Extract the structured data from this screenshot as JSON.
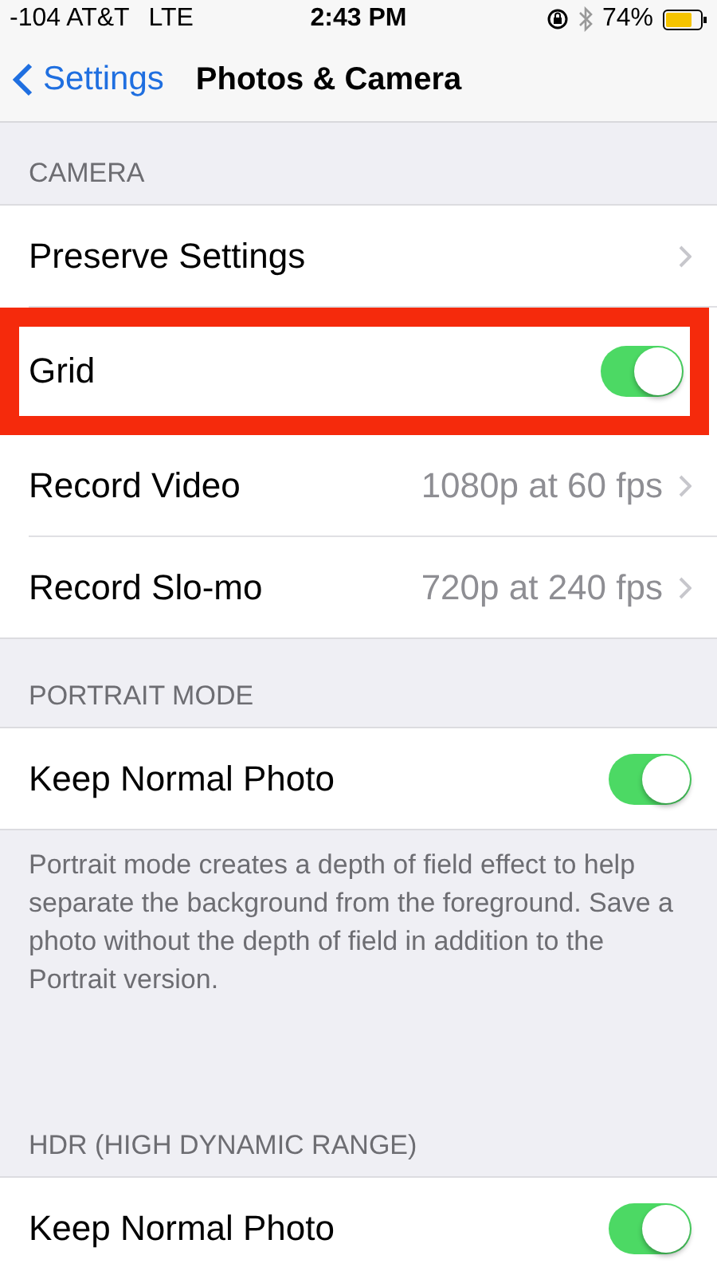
{
  "status_bar": {
    "carrier": "-104 AT&T",
    "network": "LTE",
    "time": "2:43 PM",
    "battery": "74%"
  },
  "nav": {
    "back": "Settings",
    "title": "Photos & Camera"
  },
  "sections": [
    {
      "header": "CAMERA",
      "rows": [
        {
          "kind": "link",
          "label": "Preserve Settings",
          "highlighted": false
        },
        {
          "kind": "toggle",
          "label": "Grid",
          "on": true,
          "highlighted": true
        },
        {
          "kind": "link",
          "label": "Record Video",
          "value": "1080p at 60 fps",
          "highlighted": false
        },
        {
          "kind": "link",
          "label": "Record Slo-mo",
          "value": "720p at 240 fps",
          "highlighted": false
        }
      ]
    },
    {
      "header": "PORTRAIT MODE",
      "rows": [
        {
          "kind": "toggle",
          "label": "Keep Normal Photo",
          "on": true,
          "highlighted": false
        }
      ],
      "footer": "Portrait mode creates a depth of field effect to help separate the background from the foreground. Save a photo without the depth of field in addition to the Portrait version."
    },
    {
      "header": "HDR (HIGH DYNAMIC RANGE)",
      "rows": [
        {
          "kind": "toggle",
          "label": "Keep Normal Photo",
          "on": true,
          "highlighted": false
        }
      ]
    }
  ]
}
